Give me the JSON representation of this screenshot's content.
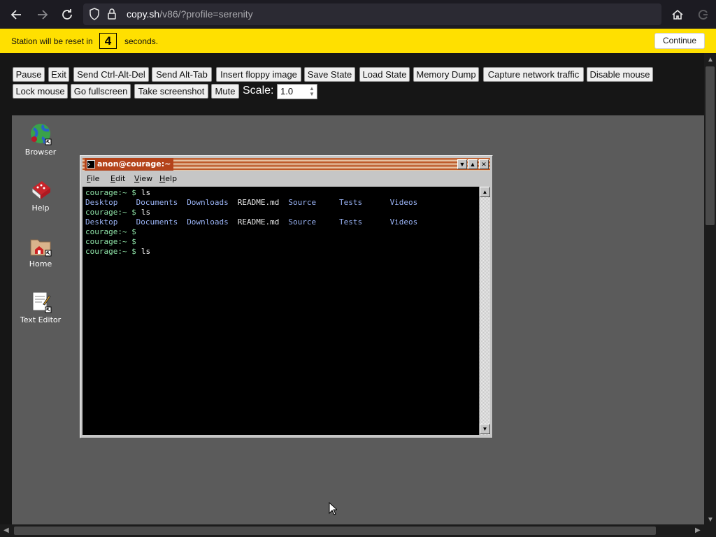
{
  "browser": {
    "url_host": "copy.sh",
    "url_path": "/v86/?profile=serenity",
    "icons": [
      "back-arrow-icon",
      "forward-arrow-icon",
      "reload-icon",
      "shield-icon",
      "lock-icon",
      "home-icon",
      "extension-icon"
    ]
  },
  "banner": {
    "prefix": "Station will be reset in",
    "countdown": "4",
    "suffix": "seconds.",
    "continue_label": "Continue"
  },
  "toolbar": {
    "buttons": [
      "Pause",
      "Exit",
      "Send Ctrl-Alt-Del",
      "Send Alt-Tab",
      "Insert floppy image",
      "Save State",
      "Load State",
      "Memory Dump",
      "Capture network traffic",
      "Disable mouse",
      "Lock mouse",
      "Go fullscreen",
      "Take screenshot",
      "Mute"
    ],
    "scale_label": "Scale:",
    "scale_value": "1.0"
  },
  "desktop": {
    "icons": [
      {
        "label": "Browser",
        "icon": "globe-icon"
      },
      {
        "label": "Help",
        "icon": "help-book-icon"
      },
      {
        "label": "Home",
        "icon": "home-folder-icon"
      },
      {
        "label": "Text Editor",
        "icon": "text-editor-icon"
      }
    ]
  },
  "terminal": {
    "title": "anon@courage:~",
    "menu": [
      "File",
      "Edit",
      "View",
      "Help"
    ],
    "prompt": "courage:~ $",
    "lines": [
      {
        "kind": "cmd",
        "text": "ls"
      },
      {
        "kind": "ls"
      },
      {
        "kind": "cmd",
        "text": "ls"
      },
      {
        "kind": "ls"
      },
      {
        "kind": "cmd",
        "text": ""
      },
      {
        "kind": "cmd",
        "text": ""
      },
      {
        "kind": "cmd",
        "text": "ls"
      }
    ],
    "ls_entries": [
      {
        "name": "Desktop",
        "type": "dir"
      },
      {
        "name": "Documents",
        "type": "dir"
      },
      {
        "name": "Downloads",
        "type": "dir"
      },
      {
        "name": "README.md",
        "type": "file"
      },
      {
        "name": "Source",
        "type": "dir"
      },
      {
        "name": "Tests",
        "type": "dir"
      },
      {
        "name": "Videos",
        "type": "dir"
      }
    ]
  },
  "colors": {
    "banner": "#ffe000",
    "prompt": "#8fe4a8",
    "directory": "#9ab3f5",
    "title_bar": "#b4431a"
  }
}
